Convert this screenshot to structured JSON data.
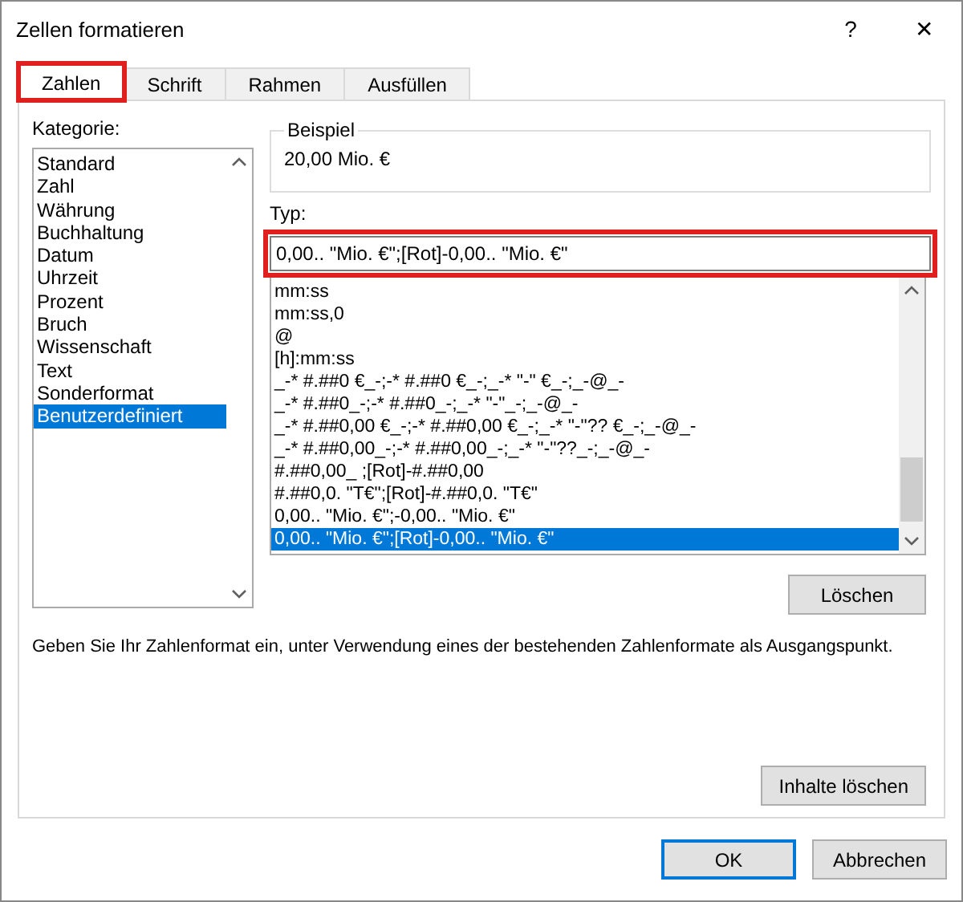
{
  "window": {
    "title": "Zellen formatieren",
    "help": "?",
    "close": "✕"
  },
  "tabs": [
    {
      "label": "Zahlen",
      "selected": true,
      "highlighted": true
    },
    {
      "label": "Schrift",
      "selected": false,
      "highlighted": false
    },
    {
      "label": "Rahmen",
      "selected": false,
      "highlighted": false
    },
    {
      "label": "Ausfüllen",
      "selected": false,
      "highlighted": false
    }
  ],
  "category": {
    "label": "Kategorie:",
    "items": [
      {
        "label": "Standard",
        "selected": false
      },
      {
        "label": "Zahl",
        "selected": false
      },
      {
        "label": "Währung",
        "selected": false
      },
      {
        "label": "Buchhaltung",
        "selected": false
      },
      {
        "label": "Datum",
        "selected": false
      },
      {
        "label": "Uhrzeit",
        "selected": false
      },
      {
        "label": "Prozent",
        "selected": false
      },
      {
        "label": "Bruch",
        "selected": false
      },
      {
        "label": "Wissenschaft",
        "selected": false
      },
      {
        "label": "Text",
        "selected": false
      },
      {
        "label": "Sonderformat",
        "selected": false
      },
      {
        "label": "Benutzerdefiniert",
        "selected": true
      }
    ]
  },
  "sample": {
    "label": "Beispiel",
    "value": "20,00 Mio. €"
  },
  "type": {
    "label": "Typ:",
    "value": "0,00.. \"Mio. €\";[Rot]-0,00.. \"Mio. €\"",
    "highlighted": true
  },
  "formats": [
    {
      "label": "mm:ss",
      "selected": false
    },
    {
      "label": "mm:ss,0",
      "selected": false
    },
    {
      "label": "@",
      "selected": false
    },
    {
      "label": "[h]:mm:ss",
      "selected": false
    },
    {
      "label": "_-* #.##0 €_-;-* #.##0 €_-;_-* \"-\" €_-;_-@_-",
      "selected": false
    },
    {
      "label": "_-* #.##0_-;-* #.##0_-;_-* \"-\"_-;_-@_-",
      "selected": false
    },
    {
      "label": "_-* #.##0,00 €_-;-* #.##0,00 €_-;_-* \"-\"?? €_-;_-@_-",
      "selected": false
    },
    {
      "label": "_-* #.##0,00_-;-* #.##0,00_-;_-* \"-\"??_-;_-@_-",
      "selected": false
    },
    {
      "label": "#.##0,00_ ;[Rot]-#.##0,00",
      "selected": false
    },
    {
      "label": "#.##0,0. \"T€\";[Rot]-#.##0,0. \"T€\"",
      "selected": false
    },
    {
      "label": "0,00.. \"Mio. €\";-0,00.. \"Mio. €\"",
      "selected": false
    },
    {
      "label": "0,00.. \"Mio. €\";[Rot]-0,00.. \"Mio. €\"",
      "selected": true
    }
  ],
  "delete_button": "Löschen",
  "description": "Geben Sie Ihr Zahlenformat ein, unter Verwendung eines der bestehenden Zahlenformate als Ausgangspunkt.",
  "clear_button": "Inhalte löschen",
  "buttons": [
    {
      "label": "OK",
      "kind": "default"
    },
    {
      "label": "Abbrechen",
      "kind": "normal"
    }
  ]
}
